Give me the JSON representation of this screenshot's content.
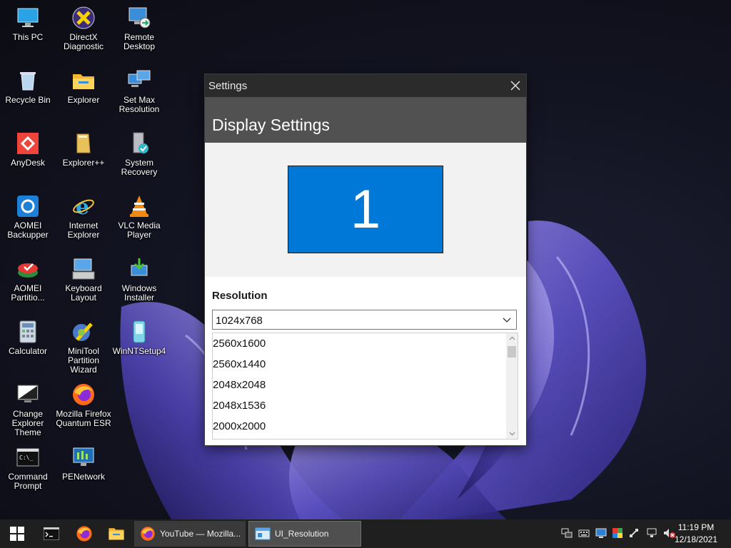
{
  "desktop_icons": [
    {
      "label": "This PC",
      "icon": "computer-icon"
    },
    {
      "label": "DirectX Diagnostic",
      "icon": "directx-icon"
    },
    {
      "label": "Remote Desktop",
      "icon": "remote-desktop-icon"
    },
    {
      "label": "Recycle Bin",
      "icon": "recycle-bin-icon"
    },
    {
      "label": "Explorer",
      "icon": "folder-icon"
    },
    {
      "label": "Set Max Resolution",
      "icon": "monitors-icon"
    },
    {
      "label": "AnyDesk",
      "icon": "anydesk-icon"
    },
    {
      "label": "Explorer++",
      "icon": "folder-plus-icon"
    },
    {
      "label": "System Recovery",
      "icon": "system-recovery-icon"
    },
    {
      "label": "AOMEI Backupper",
      "icon": "aomei-backupper-icon"
    },
    {
      "label": "Internet Explorer",
      "icon": "internet-explorer-icon"
    },
    {
      "label": "VLC Media Player",
      "icon": "vlc-icon"
    },
    {
      "label": "AOMEI Partitio...",
      "icon": "aomei-partition-icon"
    },
    {
      "label": "Keyboard Layout",
      "icon": "keyboard-icon"
    },
    {
      "label": "Windows Installer",
      "icon": "windows-installer-icon"
    },
    {
      "label": "Calculator",
      "icon": "calculator-icon"
    },
    {
      "label": "MiniTool Partition Wizard",
      "icon": "minitool-icon"
    },
    {
      "label": "WinNTSetup4",
      "icon": "winntsetup-icon"
    },
    {
      "label": "Change Explorer Theme",
      "icon": "theme-icon"
    },
    {
      "label": "Mozilla Firefox Quantum ESR",
      "icon": "firefox-icon"
    },
    {
      "label": "Command Prompt",
      "icon": "cmd-icon"
    },
    {
      "label": "PENetwork",
      "icon": "network-icon"
    }
  ],
  "window": {
    "title": "Settings",
    "header": "Display Settings",
    "monitor_number": "1",
    "resolution_label": "Resolution",
    "selected_resolution": "1024x768",
    "options": [
      "2560x1600",
      "2560x1440",
      "2048x2048",
      "2048x1536",
      "2000x2000"
    ]
  },
  "taskbar": {
    "tasks": [
      {
        "label": "YouTube — Mozilla...",
        "icon": "firefox-icon"
      },
      {
        "label": "UI_Resolution",
        "icon": "app-window-icon"
      }
    ],
    "clock_time": "11:19 PM",
    "clock_date": "12/18/2021"
  },
  "colors": {
    "monitor_blue": "#0078d7",
    "titlebar": "#2b2b2b",
    "header": "#515151",
    "taskbar": "#1f1f1f"
  }
}
